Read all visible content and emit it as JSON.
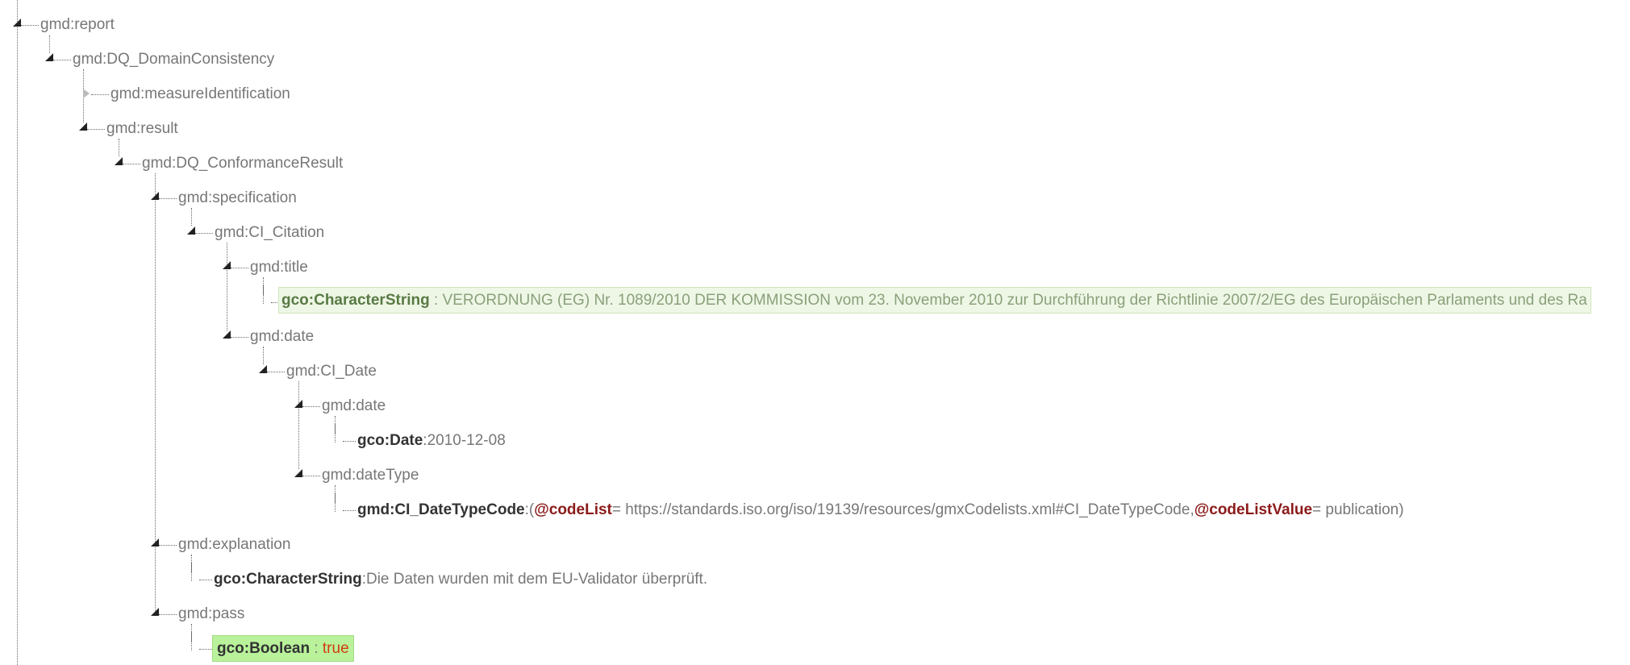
{
  "tree": {
    "report": "gmd:report",
    "domain_consistency": "gmd:DQ_DomainConsistency",
    "measure_identification": "gmd:measureIdentification",
    "result": "gmd:result",
    "conformance_result": "gmd:DQ_ConformanceResult",
    "specification": "gmd:specification",
    "ci_citation": "gmd:CI_Citation",
    "title": "gmd:title",
    "title_string": {
      "key": "gco:CharacterString",
      "sep": " : ",
      "value": "VERORDNUNG (EG) Nr. 1089/2010 DER KOMMISSION vom 23. November 2010 zur Durchführung der Richtlinie 2007/2/EG des Europäischen Parlaments und des Ra"
    },
    "date": "gmd:date",
    "ci_date": "gmd:CI_Date",
    "inner_date": "gmd:date",
    "gco_date": {
      "key": "gco:Date",
      "sep": " : ",
      "value": "2010-12-08"
    },
    "date_type": "gmd:dateType",
    "date_type_code": {
      "key": "gmd:CI_DateTypeCode",
      "sep": " : ",
      "open": "(",
      "attr1_name": "@codeList",
      "attr1_value": " = https://standards.iso.org/iso/19139/resources/gmxCodelists.xml#CI_DateTypeCode,",
      "attr2_name": "@codeListValue",
      "attr2_value": " = publication)"
    },
    "explanation": "gmd:explanation",
    "explanation_string": {
      "key": "gco:CharacterString",
      "sep": " : ",
      "value": "Die Daten wurden mit dem EU-Validator überprüft."
    },
    "pass": "gmd:pass",
    "boolean": {
      "key": "gco:Boolean",
      "sep": " : ",
      "value": "true"
    }
  }
}
